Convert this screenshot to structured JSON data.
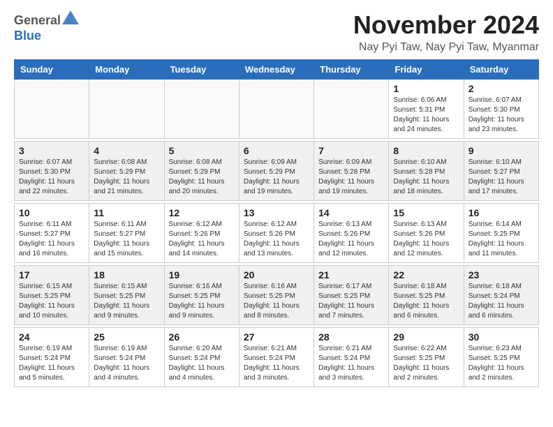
{
  "logo": {
    "general": "General",
    "blue": "Blue"
  },
  "title": "November 2024",
  "location": "Nay Pyi Taw, Nay Pyi Taw, Myanmar",
  "days_of_week": [
    "Sunday",
    "Monday",
    "Tuesday",
    "Wednesday",
    "Thursday",
    "Friday",
    "Saturday"
  ],
  "weeks": [
    {
      "shaded": false,
      "days": [
        {
          "num": "",
          "info": ""
        },
        {
          "num": "",
          "info": ""
        },
        {
          "num": "",
          "info": ""
        },
        {
          "num": "",
          "info": ""
        },
        {
          "num": "",
          "info": ""
        },
        {
          "num": "1",
          "info": "Sunrise: 6:06 AM\nSunset: 5:31 PM\nDaylight: 11 hours and 24 minutes."
        },
        {
          "num": "2",
          "info": "Sunrise: 6:07 AM\nSunset: 5:30 PM\nDaylight: 11 hours and 23 minutes."
        }
      ]
    },
    {
      "shaded": true,
      "days": [
        {
          "num": "3",
          "info": "Sunrise: 6:07 AM\nSunset: 5:30 PM\nDaylight: 11 hours and 22 minutes."
        },
        {
          "num": "4",
          "info": "Sunrise: 6:08 AM\nSunset: 5:29 PM\nDaylight: 11 hours and 21 minutes."
        },
        {
          "num": "5",
          "info": "Sunrise: 6:08 AM\nSunset: 5:29 PM\nDaylight: 11 hours and 20 minutes."
        },
        {
          "num": "6",
          "info": "Sunrise: 6:09 AM\nSunset: 5:29 PM\nDaylight: 11 hours and 19 minutes."
        },
        {
          "num": "7",
          "info": "Sunrise: 6:09 AM\nSunset: 5:28 PM\nDaylight: 11 hours and 19 minutes."
        },
        {
          "num": "8",
          "info": "Sunrise: 6:10 AM\nSunset: 5:28 PM\nDaylight: 11 hours and 18 minutes."
        },
        {
          "num": "9",
          "info": "Sunrise: 6:10 AM\nSunset: 5:27 PM\nDaylight: 11 hours and 17 minutes."
        }
      ]
    },
    {
      "shaded": false,
      "days": [
        {
          "num": "10",
          "info": "Sunrise: 6:11 AM\nSunset: 5:27 PM\nDaylight: 11 hours and 16 minutes."
        },
        {
          "num": "11",
          "info": "Sunrise: 6:11 AM\nSunset: 5:27 PM\nDaylight: 11 hours and 15 minutes."
        },
        {
          "num": "12",
          "info": "Sunrise: 6:12 AM\nSunset: 5:26 PM\nDaylight: 11 hours and 14 minutes."
        },
        {
          "num": "13",
          "info": "Sunrise: 6:12 AM\nSunset: 5:26 PM\nDaylight: 11 hours and 13 minutes."
        },
        {
          "num": "14",
          "info": "Sunrise: 6:13 AM\nSunset: 5:26 PM\nDaylight: 11 hours and 12 minutes."
        },
        {
          "num": "15",
          "info": "Sunrise: 6:13 AM\nSunset: 5:26 PM\nDaylight: 11 hours and 12 minutes."
        },
        {
          "num": "16",
          "info": "Sunrise: 6:14 AM\nSunset: 5:25 PM\nDaylight: 11 hours and 11 minutes."
        }
      ]
    },
    {
      "shaded": true,
      "days": [
        {
          "num": "17",
          "info": "Sunrise: 6:15 AM\nSunset: 5:25 PM\nDaylight: 11 hours and 10 minutes."
        },
        {
          "num": "18",
          "info": "Sunrise: 6:15 AM\nSunset: 5:25 PM\nDaylight: 11 hours and 9 minutes."
        },
        {
          "num": "19",
          "info": "Sunrise: 6:16 AM\nSunset: 5:25 PM\nDaylight: 11 hours and 9 minutes."
        },
        {
          "num": "20",
          "info": "Sunrise: 6:16 AM\nSunset: 5:25 PM\nDaylight: 11 hours and 8 minutes."
        },
        {
          "num": "21",
          "info": "Sunrise: 6:17 AM\nSunset: 5:25 PM\nDaylight: 11 hours and 7 minutes."
        },
        {
          "num": "22",
          "info": "Sunrise: 6:18 AM\nSunset: 5:25 PM\nDaylight: 11 hours and 6 minutes."
        },
        {
          "num": "23",
          "info": "Sunrise: 6:18 AM\nSunset: 5:24 PM\nDaylight: 11 hours and 6 minutes."
        }
      ]
    },
    {
      "shaded": false,
      "days": [
        {
          "num": "24",
          "info": "Sunrise: 6:19 AM\nSunset: 5:24 PM\nDaylight: 11 hours and 5 minutes."
        },
        {
          "num": "25",
          "info": "Sunrise: 6:19 AM\nSunset: 5:24 PM\nDaylight: 11 hours and 4 minutes."
        },
        {
          "num": "26",
          "info": "Sunrise: 6:20 AM\nSunset: 5:24 PM\nDaylight: 11 hours and 4 minutes."
        },
        {
          "num": "27",
          "info": "Sunrise: 6:21 AM\nSunset: 5:24 PM\nDaylight: 11 hours and 3 minutes."
        },
        {
          "num": "28",
          "info": "Sunrise: 6:21 AM\nSunset: 5:24 PM\nDaylight: 11 hours and 3 minutes."
        },
        {
          "num": "29",
          "info": "Sunrise: 6:22 AM\nSunset: 5:25 PM\nDaylight: 11 hours and 2 minutes."
        },
        {
          "num": "30",
          "info": "Sunrise: 6:23 AM\nSunset: 5:25 PM\nDaylight: 11 hours and 2 minutes."
        }
      ]
    }
  ]
}
